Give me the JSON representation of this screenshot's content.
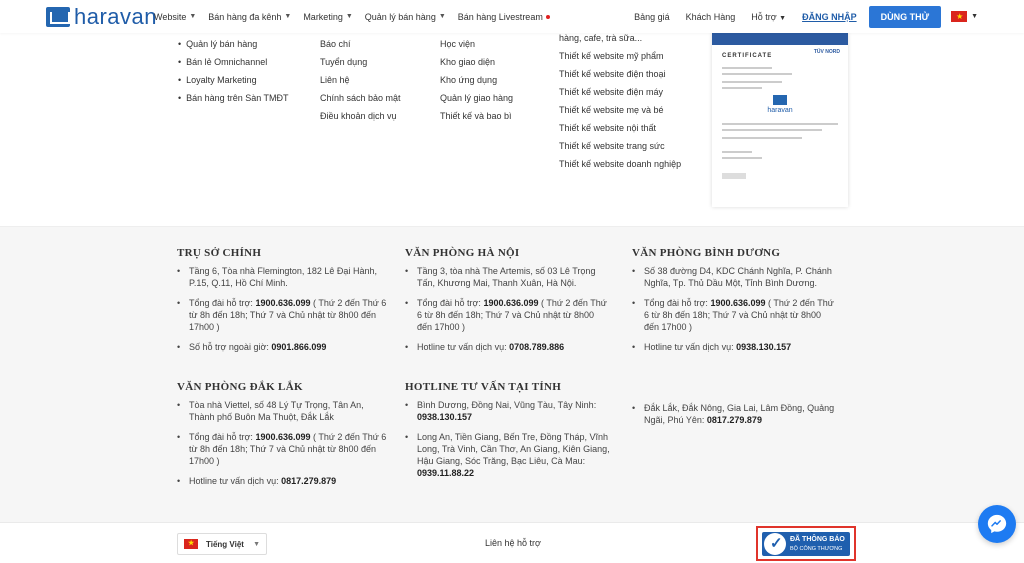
{
  "header": {
    "logo_text": "haravan",
    "nav": [
      {
        "label": "Website",
        "chevron": true
      },
      {
        "label": "Bán hàng đa kênh",
        "chevron": true
      },
      {
        "label": "Marketing",
        "chevron": true
      },
      {
        "label": "Quản lý bán hàng",
        "chevron": true
      },
      {
        "label": "Bán hàng Livestream",
        "dot": true
      }
    ],
    "pricing": "Bảng giá",
    "customers": "Khách Hàng",
    "support": "Hỗ trợ",
    "login": "ĐĂNG NHẬP",
    "trial": "DÙNG THỬ"
  },
  "links": {
    "col1": [
      "Quản lý bán hàng",
      "Bán lẻ Omnichannel",
      "Loyalty Marketing",
      "Bán hàng trên Sàn TMĐT"
    ],
    "col2": [
      "Báo chí",
      "Tuyển dụng",
      "Liên hệ",
      "Chính sách bảo mật",
      "Điều khoản dịch vụ"
    ],
    "col3": [
      "Học viện",
      "Kho giao diện",
      "Kho ứng dụng",
      "Quản lý giao hàng",
      "Thiết kế và bao bì"
    ],
    "col4": [
      "hàng, cafe, trà sữa...",
      "Thiết kế website mỹ phẩm",
      "Thiết kế website điện thoại",
      "Thiết kế website điện máy",
      "Thiết kế website mẹ và bé",
      "Thiết kế website nội thất",
      "Thiết kế website trang sức",
      "Thiết kế website doanh nghiệp"
    ]
  },
  "certificate": {
    "title": "CERTIFICATE",
    "issuer": "TÜV NORD",
    "logo": "haravan"
  },
  "offices": {
    "hq": {
      "title": "TRỤ SỞ CHÍNH",
      "address": "Tầng 6, Tòa nhà Flemington, 182 Lê Đại Hành, P.15, Q.11, Hồ Chí Minh.",
      "hotline_prefix": "Tổng đài hỗ trợ: ",
      "hotline": "1900.636.099",
      "hotline_hours": " ( Thứ 2 đến Thứ 6 từ 8h đến 18h; Thứ 7 và Chủ nhật từ 8h00 đến 17h00 )",
      "after_hours_prefix": "Số hỗ trợ ngoài giờ: ",
      "after_hours": "0901.866.099"
    },
    "hanoi": {
      "title": "VĂN PHÒNG HÀ NỘI",
      "address": "Tầng 3, tòa nhà The Artemis, số 03 Lê Trọng Tấn, Khương Mai, Thanh Xuân, Hà Nội.",
      "hotline_prefix": "Tổng đài hỗ trợ: ",
      "hotline": "1900.636.099",
      "hotline_hours": " ( Thứ 2 đến Thứ 6 từ 8h đến 18h; Thứ 7 và Chủ nhật từ 8h00 đến 17h00 )",
      "service_prefix": "Hotline tư vấn dịch vụ: ",
      "service": "0708.789.886"
    },
    "binhduong": {
      "title": "VĂN PHÒNG BÌNH DƯƠNG",
      "address": "Số 38 đường D4, KDC Chánh Nghĩa, P. Chánh Nghĩa, Tp. Thủ Dầu Một, Tỉnh Bình Dương.",
      "hotline_prefix": "Tổng đài hỗ trợ: ",
      "hotline": "1900.636.099",
      "hotline_hours": " ( Thứ 2 đến Thứ 6 từ 8h đến 18h; Thứ 7 và Chủ nhật từ 8h00 đến 17h00 )",
      "service_prefix": "Hotline tư vấn dịch vụ: ",
      "service": "0938.130.157"
    },
    "daklak": {
      "title": "VĂN PHÒNG ĐẮK LẮK",
      "address": "Tòa nhà Viettel, số 48 Lý Tự Trọng, Tân An, Thành phố Buôn Ma Thuột, Đắk Lắk",
      "hotline_prefix": "Tổng đài hỗ trợ: ",
      "hotline": "1900.636.099",
      "hotline_hours": " ( Thứ 2 đến Thứ 6 từ 8h đến 18h; Thứ 7 và Chủ nhật từ 8h00 đến 17h00 )",
      "service_prefix": "Hotline tư vấn dịch vụ: ",
      "service": "0817.279.879"
    },
    "provinces": {
      "title": "HOTLINE TƯ VẤN TẠI TỈNH",
      "group1_text": "Bình Dương, Đồng Nai, Vũng Tàu, Tây Ninh: ",
      "group1_phone": "0938.130.157",
      "group2_text": "Long An, Tiền Giang, Bến Tre, Đồng Tháp, Vĩnh Long, Trà Vinh, Cần Thơ, An Giang, Kiên Giang, Hậu Giang, Sóc Trăng, Bạc Liêu, Cà Mau: ",
      "group2_phone": "0939.11.88.22",
      "group3_text": "Đắk Lắk, Đắk Nông, Gia Lai, Lâm Đồng, Quảng Ngãi, Phú Yên: ",
      "group3_phone": "0817.279.879"
    }
  },
  "footer": {
    "language": "Tiếng Việt",
    "support_link": "Liên hệ hỗ trợ",
    "badge_line1": "ĐÃ THÔNG BÁO",
    "badge_line2": "BỘ CÔNG THƯƠNG"
  },
  "colors": {
    "brand": "#1f5ca8",
    "trial_button": "#2b76d6",
    "messenger": "#1e7bf2",
    "badge_border": "#e0342b"
  },
  "icons": [
    "logo-icon",
    "chevron-down-icon",
    "vietnam-flag-icon",
    "check-badge-icon",
    "messenger-icon"
  ]
}
